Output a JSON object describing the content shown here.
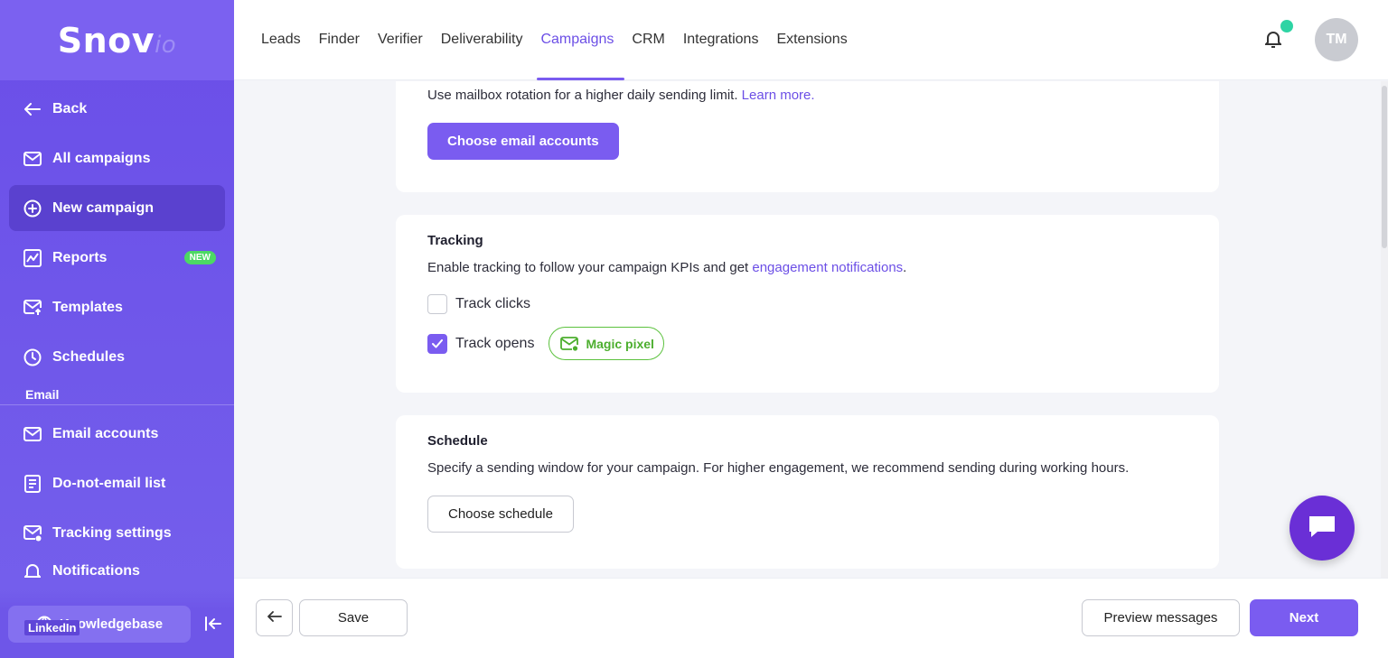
{
  "brand": {
    "name": "Snov",
    "suffix": "io"
  },
  "sidebar": {
    "back_label": "Back",
    "items": [
      {
        "label": "All campaigns",
        "icon": "mail-icon"
      },
      {
        "label": "New campaign",
        "icon": "plus-circle-icon"
      },
      {
        "label": "Reports",
        "icon": "chart-icon",
        "badge": "NEW"
      },
      {
        "label": "Templates",
        "icon": "mail-template-icon"
      },
      {
        "label": "Schedules",
        "icon": "clock-icon"
      }
    ],
    "section_email": "Email",
    "email_items": [
      {
        "label": "Email accounts",
        "icon": "mail-icon"
      },
      {
        "label": "Do-not-email list",
        "icon": "list-icon"
      },
      {
        "label": "Tracking settings",
        "icon": "tracking-mail-icon"
      },
      {
        "label": "Notifications",
        "icon": "bell-icon"
      }
    ],
    "knowledgebase_label": "Knowledgebase",
    "linkedin_label": "LinkedIn"
  },
  "topnav": {
    "items": [
      "Leads",
      "Finder",
      "Verifier",
      "Deliverability",
      "Campaigns",
      "CRM",
      "Integrations",
      "Extensions"
    ],
    "active": "Campaigns",
    "avatar_initials": "TM"
  },
  "accounts_card": {
    "text": "Use mailbox rotation for a higher daily sending limit.",
    "link": "Learn more.",
    "button": "Choose email accounts"
  },
  "tracking_card": {
    "title": "Tracking",
    "text": "Enable tracking to follow your campaign KPIs and get",
    "link": "engagement notifications",
    "text_end": ".",
    "track_clicks": "Track clicks",
    "track_opens": "Track opens",
    "magic_pixel": "Magic pixel"
  },
  "schedule_card": {
    "title": "Schedule",
    "text": "Specify a sending window for your campaign. For higher engagement, we recommend sending during working hours.",
    "button": "Choose schedule"
  },
  "footer": {
    "save": "Save",
    "preview": "Preview messages",
    "next": "Next"
  },
  "colors": {
    "accent": "#7a5cf0",
    "sidebar": "#6a4ee8",
    "success": "#4cae2e",
    "chat": "#6a2fd6"
  }
}
